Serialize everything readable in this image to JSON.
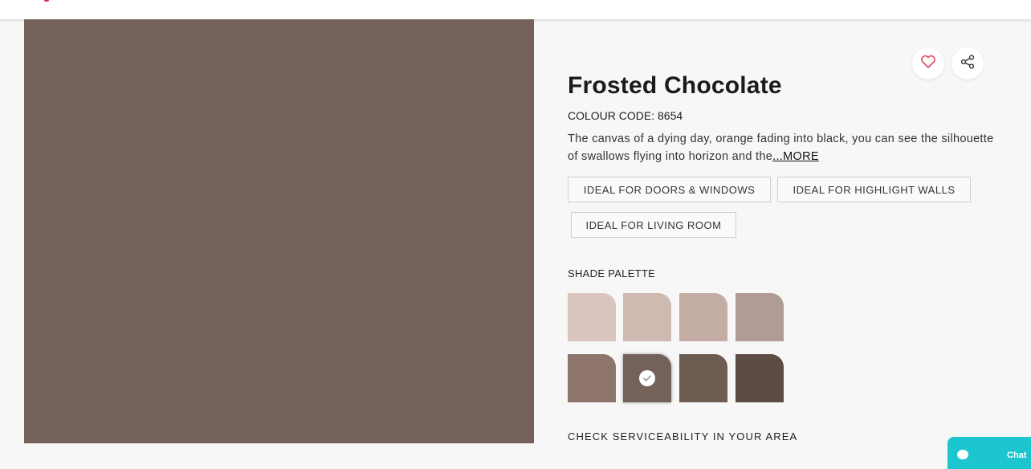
{
  "header": {
    "logo_fragment_color": "#e0324b"
  },
  "preview": {
    "color": "#74615a"
  },
  "actions": {
    "favorite_icon": "heart-icon",
    "share_icon": "share-icon",
    "favorite_color": "#d9465a"
  },
  "product": {
    "name": "Frosted Chocolate",
    "colour_code": "COLOUR CODE: 8654",
    "description_line1": "The canvas of a dying day, orange fading into black, you can see the silhouette",
    "description_line2": "of swallows flying into horizon and the",
    "more_label": "...MORE"
  },
  "tags": [
    "IDEAL FOR DOORS & WINDOWS",
    "IDEAL FOR HIGHLIGHT WALLS",
    "IDEAL FOR LIVING ROOM"
  ],
  "palette": {
    "label": "SHADE PALETTE",
    "shades": [
      {
        "color": "#dac6bf",
        "selected": false
      },
      {
        "color": "#cfbab1",
        "selected": false
      },
      {
        "color": "#c3ada4",
        "selected": false
      },
      {
        "color": "#b09b95",
        "selected": false
      },
      {
        "color": "#8d756e",
        "selected": false
      },
      {
        "color": "#74615a",
        "selected": true
      },
      {
        "color": "#6c5c52",
        "selected": false
      },
      {
        "color": "#5d4b44",
        "selected": false
      }
    ]
  },
  "serviceability": {
    "label": "CHECK SERVICEABILITY IN YOUR AREA"
  },
  "chat": {
    "label": "Chat",
    "color": "#1bc6cf"
  }
}
